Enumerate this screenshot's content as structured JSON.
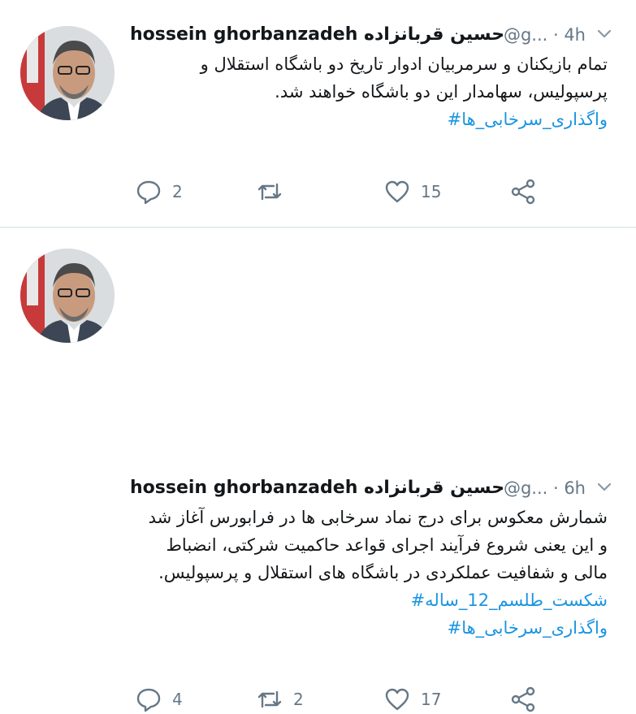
{
  "tweets": [
    {
      "display_name": "hossein ghorbanzadeh حسین قربانزاده",
      "handle_time": "@g... · 4h",
      "text_lines": [
        "تمام بازیکنان و سرمربیان ادوار تاریخ دو باشگاه استقلال و",
        "پرسپولیس، سهامدار این دو باشگاه خواهند شد."
      ],
      "hashtags": [
        "واگذاری_سرخابی_ها#"
      ],
      "reply_count": "2",
      "retweet_count": "",
      "like_count": "15"
    },
    {
      "display_name": "hossein ghorbanzadeh حسین قربانزاده",
      "handle_time": "@g... · 6h",
      "text_lines": [
        "شمارش معکوس برای درج نماد سرخابی ها در فرابورس آغاز شد",
        "و این یعنی شروع فرآیند اجرای قواعد حاکمیت شرکتی، انضباط",
        "مالی و شفافیت عملکردی در باشگاه های استقلال و پرسپولیس."
      ],
      "hashtags": [
        "شکست_طلسم_12_ساله#",
        "واگذاری_سرخابی_ها#"
      ],
      "reply_count": "4",
      "retweet_count": "2",
      "like_count": "17"
    }
  ],
  "icons": {
    "reply": "reply-icon",
    "retweet": "retweet-icon",
    "like": "heart-icon",
    "share": "share-icon",
    "caret": "chevron-down-icon"
  },
  "colors": {
    "text": "#14171a",
    "muted": "#657786",
    "hashtag": "#1b95e0",
    "divider": "#e6ecf0"
  }
}
